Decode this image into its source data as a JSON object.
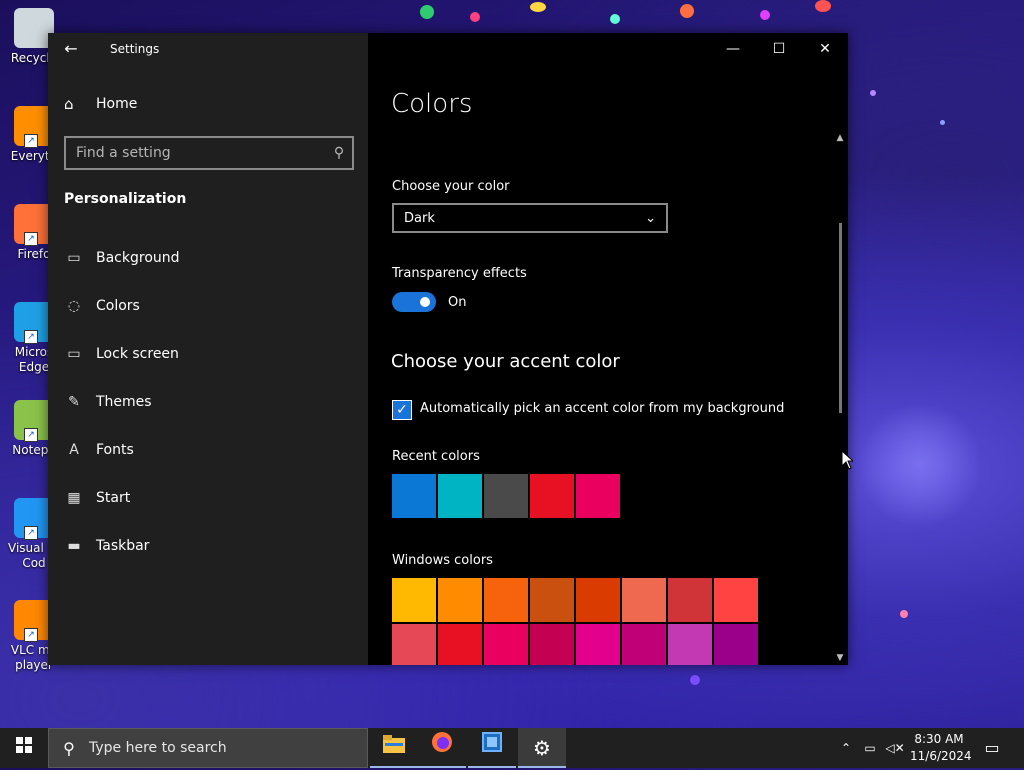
{
  "window": {
    "app_title": "Settings",
    "back_icon": "←",
    "controls": {
      "minimize": "—",
      "maximize": "☐",
      "close": "✕"
    }
  },
  "sidebar": {
    "home_label": "Home",
    "search_placeholder": "Find a setting",
    "section_title": "Personalization",
    "items": [
      {
        "label": "Background",
        "icon": "picture-icon"
      },
      {
        "label": "Colors",
        "icon": "palette-icon"
      },
      {
        "label": "Lock screen",
        "icon": "lock-screen-icon"
      },
      {
        "label": "Themes",
        "icon": "themes-icon"
      },
      {
        "label": "Fonts",
        "icon": "fonts-icon"
      },
      {
        "label": "Start",
        "icon": "start-icon"
      },
      {
        "label": "Taskbar",
        "icon": "taskbar-icon"
      }
    ]
  },
  "content": {
    "title": "Colors",
    "choose_color_label": "Choose your color",
    "choose_color_value": "Dark",
    "transparency_label": "Transparency effects",
    "transparency_state": "On",
    "transparency_on": true,
    "accent_title": "Choose your accent color",
    "auto_accent_label": "Automatically pick an accent color from my background",
    "auto_accent_checked": true,
    "recent_colors_label": "Recent colors",
    "recent_colors": [
      "#0a78d4",
      "#00b4c3",
      "#4a4a4a",
      "#e81123",
      "#ea005e"
    ],
    "windows_colors_label": "Windows colors",
    "windows_colors_row1": [
      "#ffb900",
      "#ff8c00",
      "#f7630c",
      "#ca5010",
      "#da3b01",
      "#ef6950",
      "#d13438",
      "#ff4343"
    ],
    "windows_colors_row2": [
      "#e74856",
      "#e81123",
      "#ea005e",
      "#c30052",
      "#e3008c",
      "#bf0077",
      "#c239b3",
      "#9a0089"
    ]
  },
  "desktop_icons": [
    {
      "label": "Recycle",
      "icon": "recycle-bin-icon",
      "color": "#cfd8dc"
    },
    {
      "label": "Everyth",
      "icon": "everything-search-icon",
      "color": "#ff8f00"
    },
    {
      "label": "Firefo",
      "icon": "firefox-icon",
      "color": "#ff7139"
    },
    {
      "label": "Micros Edge",
      "icon": "edge-icon",
      "color": "#1fa0e6"
    },
    {
      "label": "Notepa",
      "icon": "notepad-plus-icon",
      "color": "#8bc34a"
    },
    {
      "label": "Visual St Cod",
      "icon": "vscode-icon",
      "color": "#2196f3"
    },
    {
      "label": "VLC me player",
      "icon": "vlc-icon",
      "color": "#ff8800"
    }
  ],
  "taskbar": {
    "search_placeholder": "Type here to search",
    "time": "8:30 AM",
    "date": "11/6/2024",
    "apps": [
      "file-explorer-icon",
      "firefox-icon",
      "virtualbox-icon",
      "settings-gear-icon"
    ]
  }
}
